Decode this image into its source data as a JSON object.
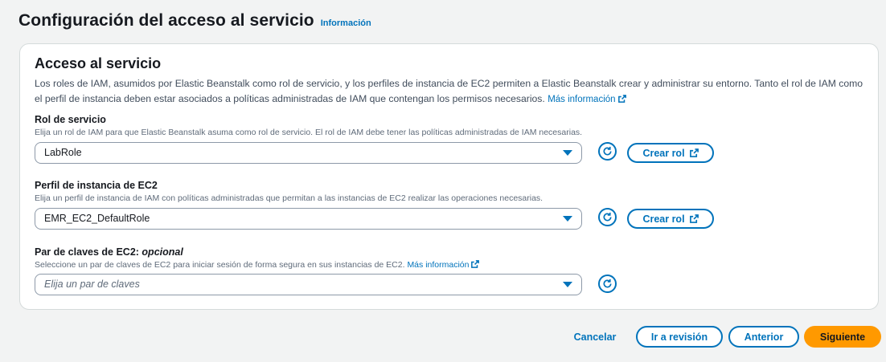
{
  "header": {
    "title": "Configuración del acceso al servicio",
    "info_link": "Información"
  },
  "section": {
    "title": "Acceso al servicio",
    "description": "Los roles de IAM, asumidos por Elastic Beanstalk como rol de servicio, y los perfiles de instancia de EC2 permiten a Elastic Beanstalk crear y administrar su entorno. Tanto el rol de IAM como el perfil de instancia deben estar asociados a políticas administradas de IAM que contengan los permisos necesarios.",
    "more_info_link": "Más información"
  },
  "service_role": {
    "label": "Rol de servicio",
    "description": "Elija un rol de IAM para que Elastic Beanstalk asuma como rol de servicio. El rol de IAM debe tener las políticas administradas de IAM necesarias.",
    "selected_value": "LabRole",
    "create_button": "Crear rol"
  },
  "instance_profile": {
    "label": "Perfil de instancia de EC2",
    "description": "Elija un perfil de instancia de IAM con políticas administradas que permitan a las instancias de EC2 realizar las operaciones necesarias.",
    "selected_value": "EMR_EC2_DefaultRole",
    "create_button": "Crear rol"
  },
  "key_pair": {
    "label": "Par de claves de EC2:",
    "label_optional": "opcional",
    "description": "Seleccione un par de claves de EC2 para iniciar sesión de forma segura en sus instancias de EC2.",
    "more_info_link": "Más información",
    "placeholder": "Elija un par de claves"
  },
  "footer": {
    "cancel": "Cancelar",
    "review": "Ir a revisión",
    "previous": "Anterior",
    "next": "Siguiente"
  },
  "icons": {
    "external": "external-link-icon",
    "refresh": "refresh-icon",
    "dropdown": "caret-down-icon"
  },
  "colors": {
    "accent": "#0073bb",
    "primary_button": "#ff9900",
    "background": "#f2f3f3",
    "panel": "#ffffff"
  }
}
